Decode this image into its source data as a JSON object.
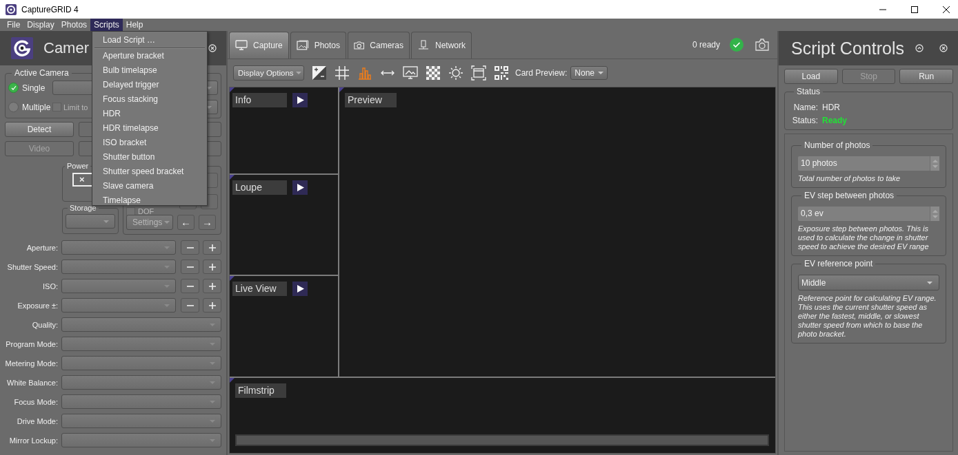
{
  "window": {
    "title": "CaptureGRID 4"
  },
  "menu_bar": [
    {
      "label": "File",
      "selected": false
    },
    {
      "label": "Display",
      "selected": false
    },
    {
      "label": "Photos",
      "selected": false
    },
    {
      "label": "Scripts",
      "selected": true
    },
    {
      "label": "Help",
      "selected": false
    }
  ],
  "open_menu": {
    "first_item": "Load Script …",
    "items": [
      "Aperture bracket",
      "Bulb timelapse",
      "Delayed trigger",
      "Focus stacking",
      "HDR",
      "HDR timelapse",
      "ISO bracket",
      "Shutter button",
      "Shutter speed bracket",
      "Slave camera",
      "Timelapse"
    ]
  },
  "camera_panel": {
    "title": "Camer",
    "active_camera": {
      "label": "Active Camera",
      "modes": [
        {
          "label": "Single",
          "selected": true
        },
        {
          "label": "Multiple",
          "selected": false
        }
      ],
      "limit": {
        "label": "Limit to",
        "checked": false,
        "disabled": true
      }
    },
    "buttons": [
      {
        "label": "Detect",
        "disabled": false
      },
      {
        "label": "Video",
        "disabled": true
      }
    ],
    "power": {
      "label": "Power",
      "box": "×"
    },
    "storage": {
      "label": "Storage"
    },
    "dof": {
      "label": "DOF",
      "checked": false,
      "disabled": true
    },
    "settings_button": {
      "label": "Settings",
      "disabled": true
    },
    "arrows": [
      "←",
      "→"
    ],
    "settings": [
      {
        "label": "Aperture:",
        "kind": "stepper"
      },
      {
        "label": "Shutter Speed:",
        "kind": "stepper"
      },
      {
        "label": "ISO:",
        "kind": "stepper"
      },
      {
        "label": "Exposure ±:",
        "kind": "stepper"
      },
      {
        "label": "Quality:",
        "kind": "select"
      },
      {
        "label": "Program Mode:",
        "kind": "select"
      },
      {
        "label": "Metering Mode:",
        "kind": "select"
      },
      {
        "label": "White Balance:",
        "kind": "select"
      },
      {
        "label": "Focus Mode:",
        "kind": "select"
      },
      {
        "label": "Drive Mode:",
        "kind": "select"
      },
      {
        "label": "Mirror Lockup:",
        "kind": "select"
      }
    ]
  },
  "tabs": [
    {
      "label": "Capture",
      "kind": "monitor",
      "selected": true
    },
    {
      "label": "Photos",
      "kind": "image",
      "selected": false
    },
    {
      "label": "Cameras",
      "kind": "camera",
      "selected": false
    },
    {
      "label": "Network",
      "kind": "network",
      "selected": false
    }
  ],
  "ready_status": {
    "text": "0 ready"
  },
  "toolbar": {
    "display_options": "Display Options",
    "tools": [
      {
        "kind": "exposure",
        "active": false
      },
      {
        "kind": "grid",
        "active": false
      },
      {
        "kind": "histogram",
        "active": true
      },
      {
        "kind": "width",
        "active": false
      },
      {
        "kind": "monitor",
        "active": false
      },
      {
        "kind": "checker",
        "active": false
      },
      {
        "kind": "brightness",
        "active": false
      },
      {
        "kind": "frame",
        "active": false
      },
      {
        "kind": "qr",
        "active": false
      }
    ],
    "card_preview_label": "Card Preview:",
    "card_preview_value": "None"
  },
  "panels": {
    "info": "Info",
    "loupe": "Loupe",
    "live_view": "Live View",
    "preview": "Preview",
    "filmstrip": "Filmstrip"
  },
  "script_controls": {
    "title": "Script Controls",
    "buttons": [
      {
        "label": "Load",
        "disabled": false
      },
      {
        "label": "Stop",
        "disabled": true
      },
      {
        "label": "Run",
        "disabled": false
      }
    ],
    "status": {
      "label": "Status",
      "name_label": "Name:",
      "name": "HDR",
      "status_label": "Status:",
      "status": "Ready"
    },
    "params": [
      {
        "kind": "spin",
        "label": "Number of photos",
        "value": "10 photos",
        "help": "Total number of photos to take"
      },
      {
        "kind": "spin",
        "label": "EV step between photos",
        "value": "0,3 ev",
        "help": "Exposure step between photos. This is used to calculate the change in shutter speed to achieve the desired EV range"
      },
      {
        "kind": "select",
        "label": "EV reference point",
        "value": "Middle",
        "help": "Reference point for calculating EV range. This uses the current shutter speed as either the fastest, middle, or slowest shutter speed from which to base the photo bracket."
      }
    ]
  }
}
